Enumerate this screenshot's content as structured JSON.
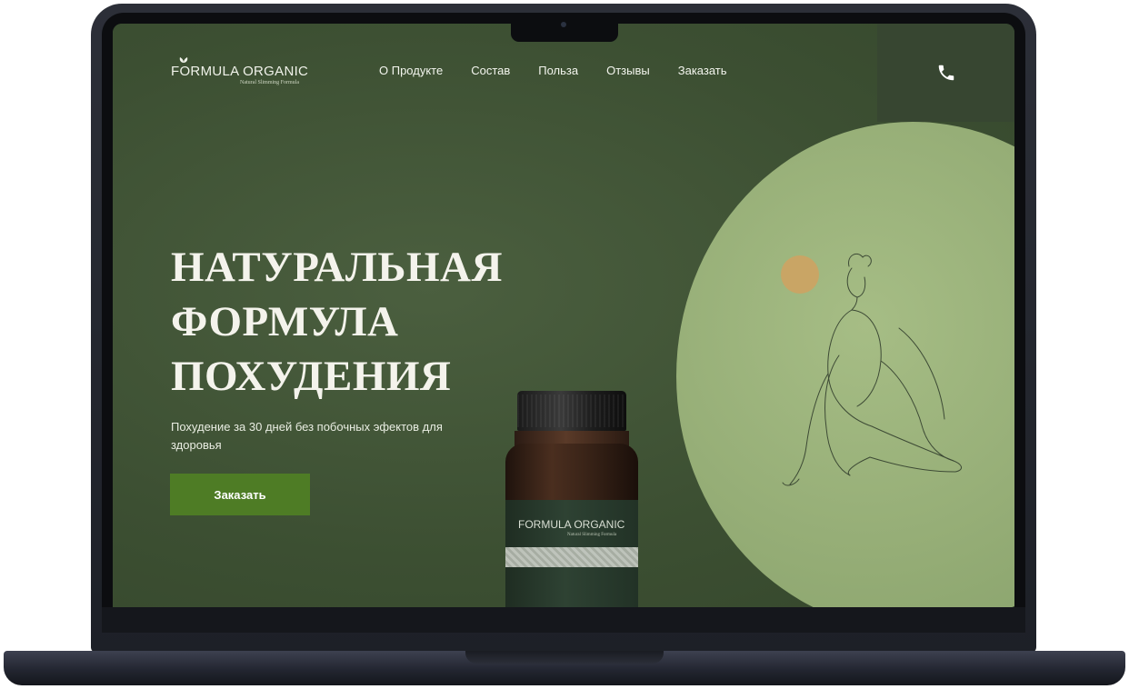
{
  "brand": {
    "name": "FORMULA ORGANIC",
    "tagline": "Natural Slimming Formula"
  },
  "nav": {
    "items": [
      "О Продукте",
      "Состав",
      "Польза",
      "Отзывы",
      "Заказать"
    ]
  },
  "hero": {
    "title_lines": [
      "НАТУРАЛЬНАЯ",
      "ФОРМУЛА",
      "ПОХУДЕНИЯ"
    ],
    "subtitle": "Похудение за 30 дней без побочных эфектов для здоровья",
    "cta_label": "Заказать"
  },
  "product": {
    "label_title": "FORMULA ORGANIC",
    "label_sub": "Natural Slimming Formula"
  },
  "icons": {
    "phone": "phone-icon",
    "logo_leaf": "leaf-icon"
  },
  "colors": {
    "background": "#3f5334",
    "circle": "#9bb27b",
    "phone_box": "#374631",
    "sun": "#c9a565",
    "cta": "#4e7c25"
  }
}
